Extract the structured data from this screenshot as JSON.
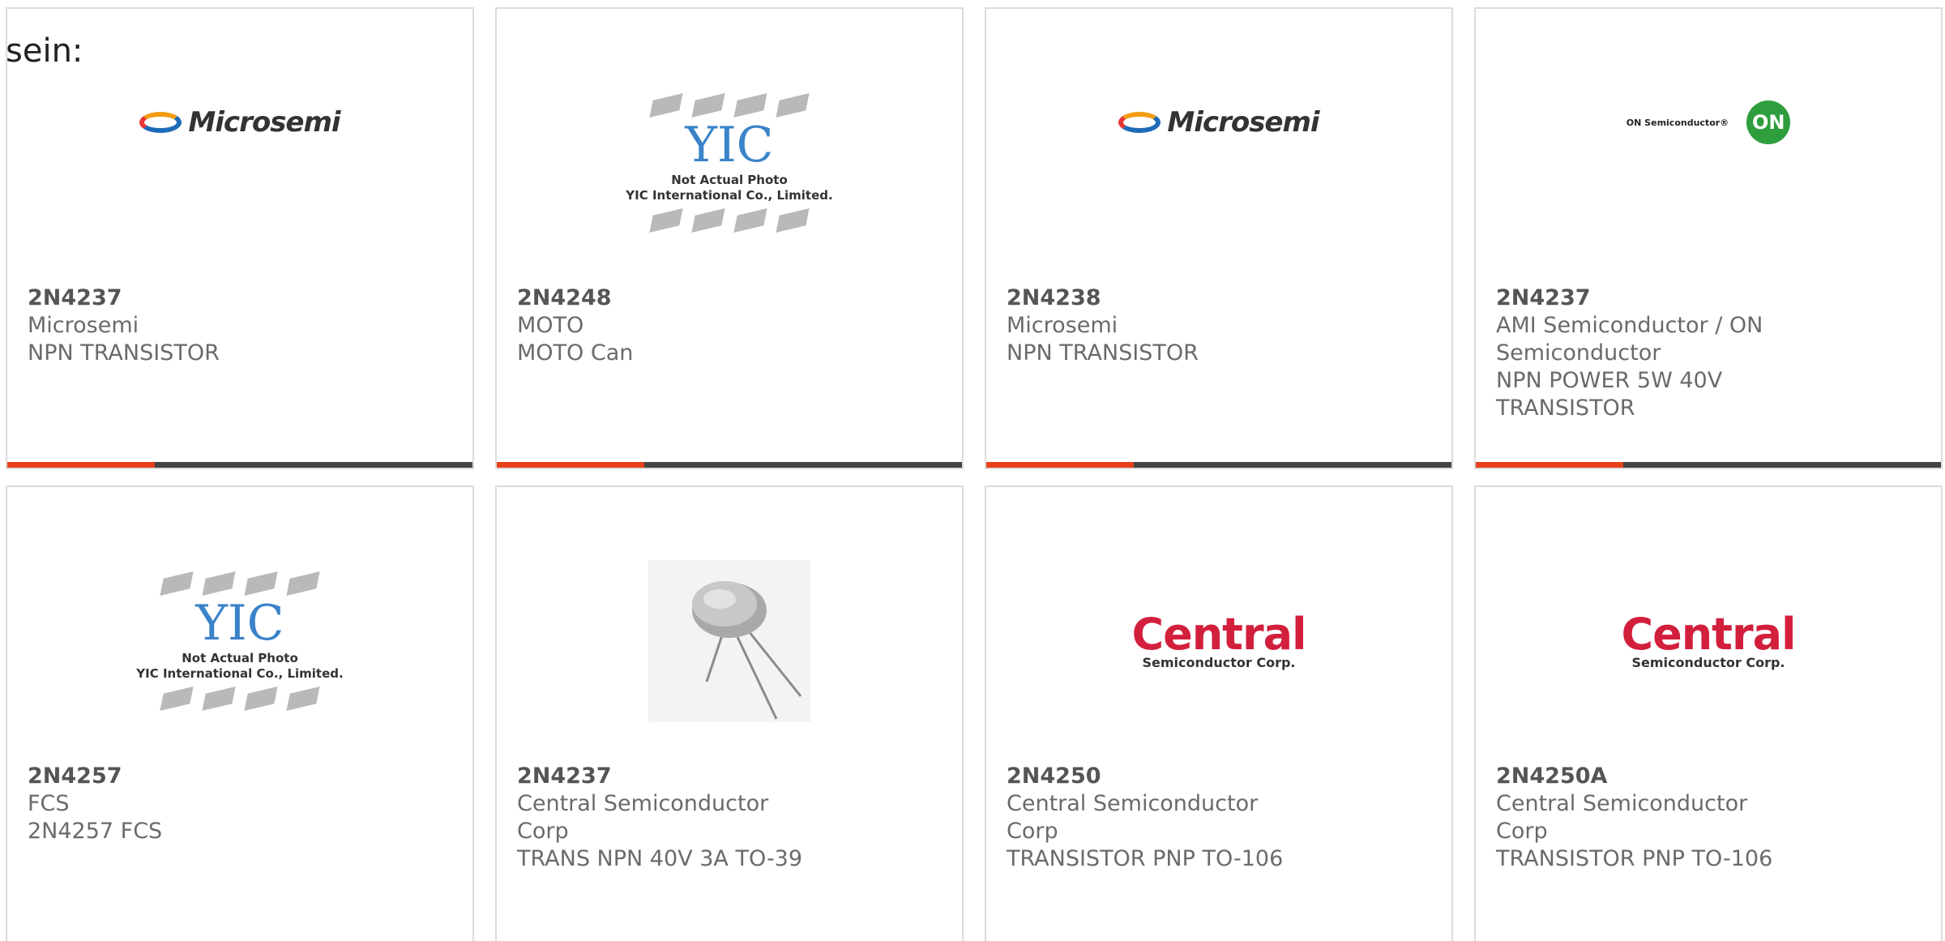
{
  "header_text": "sein:",
  "cards": [
    {
      "part": "2N4237",
      "maker": "Microsemi",
      "desc": "NPN TRANSISTOR",
      "logo": "Microsemi"
    },
    {
      "part": "2N4248",
      "maker": "MOTO",
      "desc": "MOTO Can",
      "logo_line1": "Not Actual Photo",
      "logo_line2": "YIC International Co., Limited.",
      "logo_mark": "YIC"
    },
    {
      "part": "2N4238",
      "maker": "Microsemi",
      "desc": "NPN TRANSISTOR",
      "logo": "Microsemi"
    },
    {
      "part": "2N4237",
      "maker": "AMI Semiconductor / ON Semiconductor",
      "desc": "NPN POWER 5W 40V TRANSISTOR",
      "logo_text": "ON Semiconductor®",
      "logo_circle": "ON"
    },
    {
      "part": "2N4257",
      "maker": "FCS",
      "desc": "2N4257 FCS",
      "logo_line1": "Not Actual Photo",
      "logo_line2": "YIC International Co., Limited.",
      "logo_mark": "YIC"
    },
    {
      "part": "2N4237",
      "maker": "Central Semiconductor Corp",
      "desc": "TRANS NPN 40V 3A TO-39"
    },
    {
      "part": "2N4250",
      "maker": "Central Semiconductor Corp",
      "desc": "TRANSISTOR PNP TO-106",
      "logo_main": "Central",
      "logo_sub": "Semiconductor Corp."
    },
    {
      "part": "2N4250A",
      "maker": "Central Semiconductor Corp",
      "desc": "TRANSISTOR PNP TO-106",
      "logo_main": "Central",
      "logo_sub": "Semiconductor Corp."
    }
  ],
  "colors": {
    "accent": "#e8401a",
    "bar": "#444444",
    "border": "#dcdcdc"
  }
}
